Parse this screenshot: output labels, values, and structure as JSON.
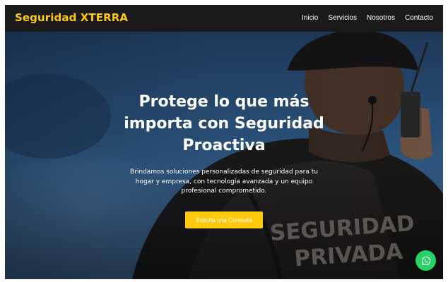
{
  "navbar": {
    "brand": "Seguridad XTERRA",
    "links": [
      "Inicio",
      "Servicios",
      "Nosotros",
      "Contacto"
    ]
  },
  "hero": {
    "headline_lines": [
      "Protege lo que más",
      "importa con Seguridad",
      "Proactiva"
    ],
    "subtext_lines": [
      "Brindamos soluciones personalizadas de seguridad para tu",
      "hogar y empresa, con tecnología avanzada y un equipo",
      "profesional comprometido."
    ],
    "cta_label": "Solicita una Consulta",
    "vest_text": [
      "SEGURIDAD",
      "PRIVADA"
    ]
  },
  "floating": {
    "icon": "whatsapp-icon"
  },
  "colors": {
    "accent": "#ffc90e",
    "navbar_bg": "#1a1a1a",
    "whatsapp": "#25d366"
  }
}
